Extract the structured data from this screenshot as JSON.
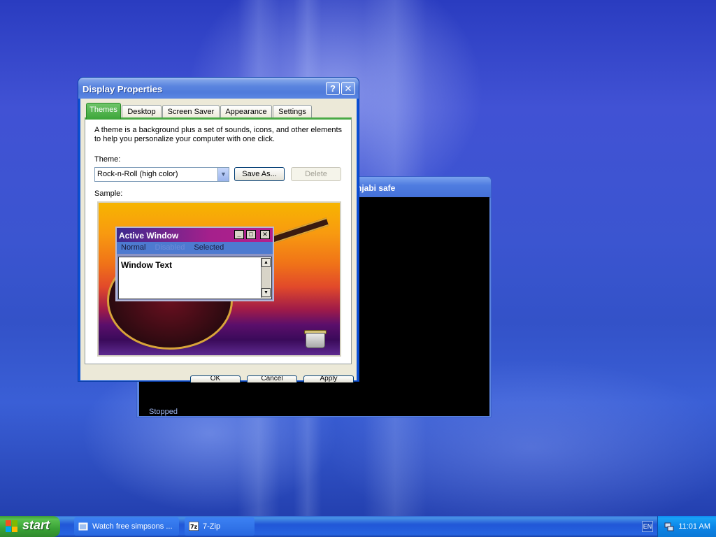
{
  "desktop": {
    "accent": "#3b55d0"
  },
  "media_window": {
    "title": "njabi safe",
    "status": "Stopped"
  },
  "dialog": {
    "title": "Display Properties",
    "help_glyph": "?",
    "close_glyph": "✕",
    "tabs": [
      {
        "label": "Themes",
        "active": true
      },
      {
        "label": "Desktop"
      },
      {
        "label": "Screen Saver"
      },
      {
        "label": "Appearance"
      },
      {
        "label": "Settings"
      }
    ],
    "description": "A theme is a background plus a set of sounds, icons, and other elements to help you personalize your computer with one click.",
    "theme_label": "Theme:",
    "theme_value": "Rock-n-Roll (high color)",
    "save_as_label": "Save As...",
    "delete_label": "Delete",
    "sample_label": "Sample:",
    "sample": {
      "window_title": "Active Window",
      "menu_normal": "Normal",
      "menu_disabled": "Disabled",
      "menu_selected": "Selected",
      "window_text": "Window Text"
    },
    "ok_label": "OK",
    "cancel_label": "Cancel",
    "apply_label": "Apply"
  },
  "taskbar": {
    "start_label": "start",
    "tasks": [
      {
        "label": "Watch free simpsons ...",
        "icon": "folder-icon"
      },
      {
        "label": "7-Zip",
        "icon": "7zip-icon"
      }
    ],
    "language": "EN",
    "clock": "11:01 AM"
  }
}
